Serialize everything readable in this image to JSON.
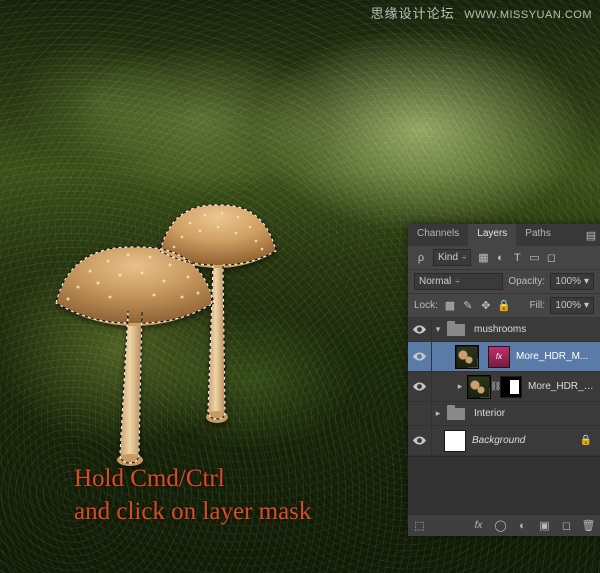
{
  "watermark": {
    "cn": "思缘设计论坛",
    "url": "WWW.MISSYUAN.COM"
  },
  "instruction": {
    "line1": "Hold Cmd/Ctrl",
    "line2": "and click on layer mask"
  },
  "panel": {
    "tabs": {
      "channels": "Channels",
      "layers": "Layers",
      "paths": "Paths"
    },
    "filter": {
      "kind": "Kind",
      "opacity_label": "Opacity:",
      "opacity_value": "100%",
      "blend": "Normal",
      "lock_label": "Lock:",
      "fill_label": "Fill:",
      "fill_value": "100%"
    },
    "groups": {
      "mushrooms": "mushrooms",
      "interior": "Interior"
    },
    "layers": {
      "hdr1": "More_HDR_M...",
      "hdr2": "More_HDR_M...",
      "background": "Background"
    }
  }
}
